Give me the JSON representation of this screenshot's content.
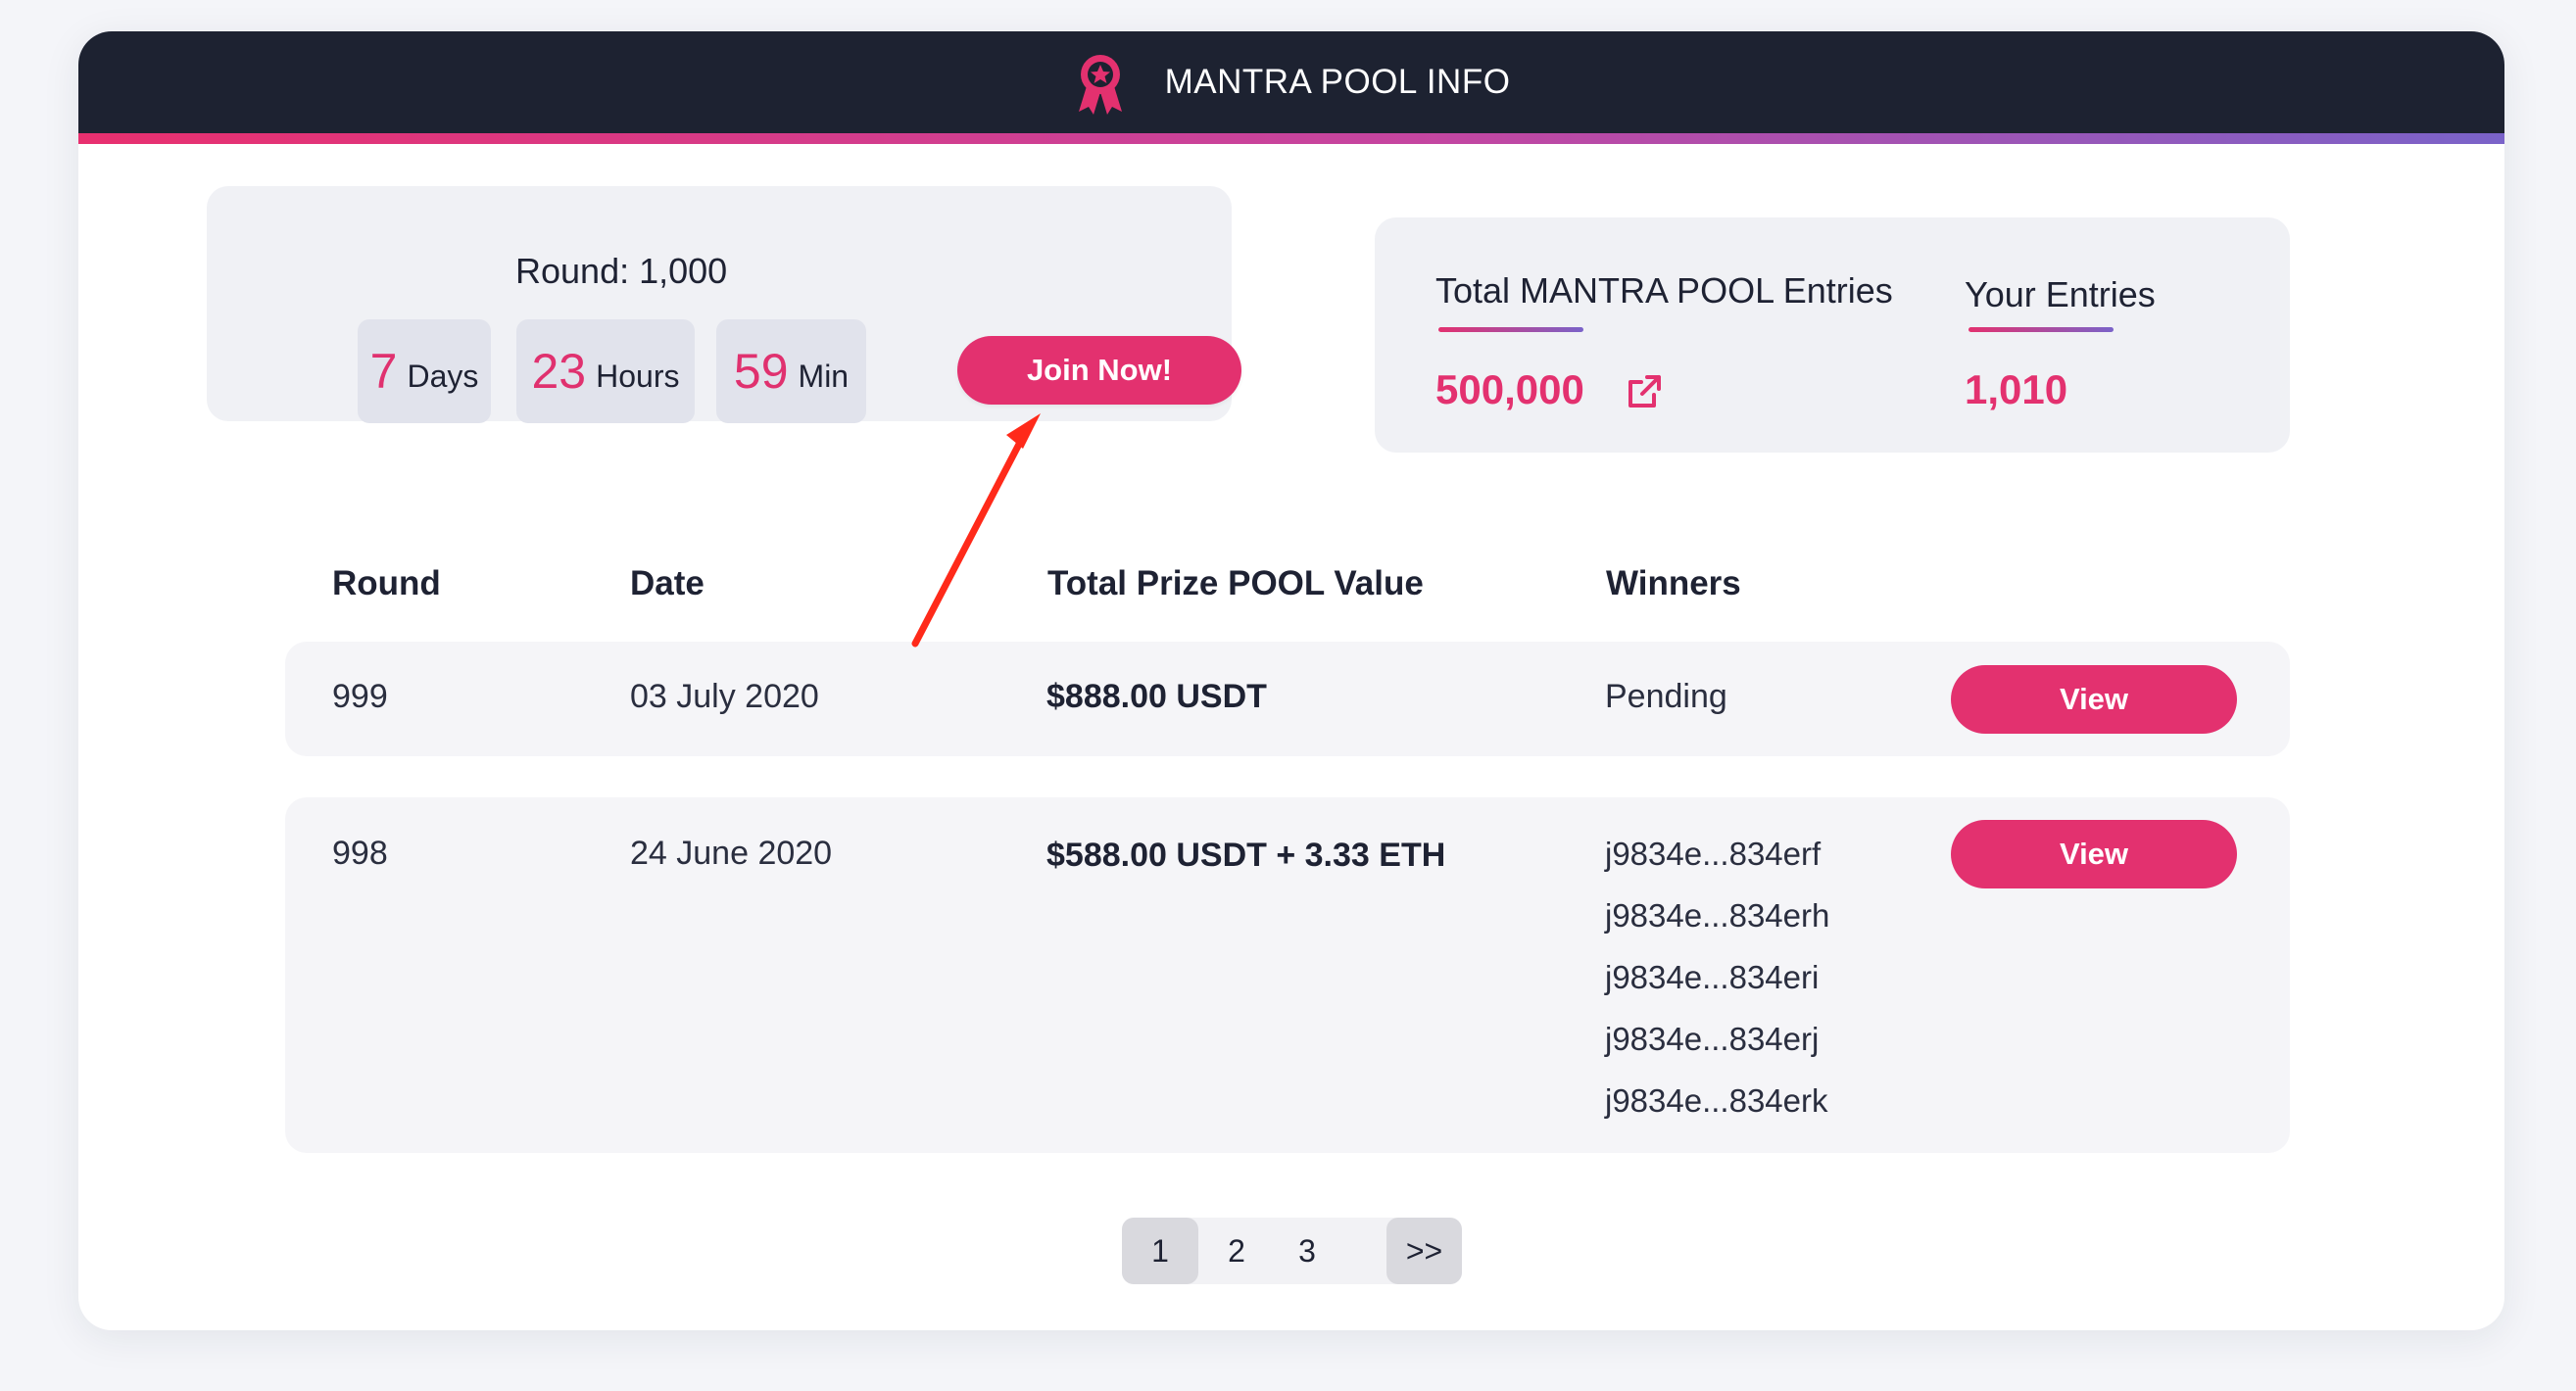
{
  "header": {
    "title": "MANTRA POOL INFO",
    "icon": "award-ribbon-icon",
    "accent": "#e3316f"
  },
  "countdown": {
    "round_label": "Round: 1,000",
    "days_value": "7",
    "days_unit": "Days",
    "hours_value": "23",
    "hours_unit": "Hours",
    "min_value": "59",
    "min_unit": "Min",
    "join_label": "Join Now!"
  },
  "stats": {
    "total_label": "Total MANTRA POOL Entries",
    "total_value": "500,000",
    "your_label": "Your Entries",
    "your_value": "1,010"
  },
  "table": {
    "headers": [
      "Round",
      "Date",
      "Total Prize POOL Value",
      "Winners"
    ],
    "rows": [
      {
        "round": "999",
        "date": "03 July 2020",
        "prize": "$888.00 USDT",
        "winners": [
          "Pending"
        ],
        "action": "View"
      },
      {
        "round": "998",
        "date": "24 June 2020",
        "prize": "$588.00 USDT + 3.33 ETH",
        "winners": [
          "j9834e...834erf",
          "j9834e...834erh",
          "j9834e...834eri",
          "j9834e...834erj",
          "j9834e...834erk"
        ],
        "action": "View"
      }
    ]
  },
  "pagination": {
    "pages": [
      "1",
      "2",
      "3"
    ],
    "next": ">>",
    "active": "1"
  },
  "colors": {
    "header_bg": "#1d2231",
    "accent": "#e3316f",
    "panel_bg": "#f0f1f5",
    "annotation_arrow": "#ff2a1a"
  }
}
